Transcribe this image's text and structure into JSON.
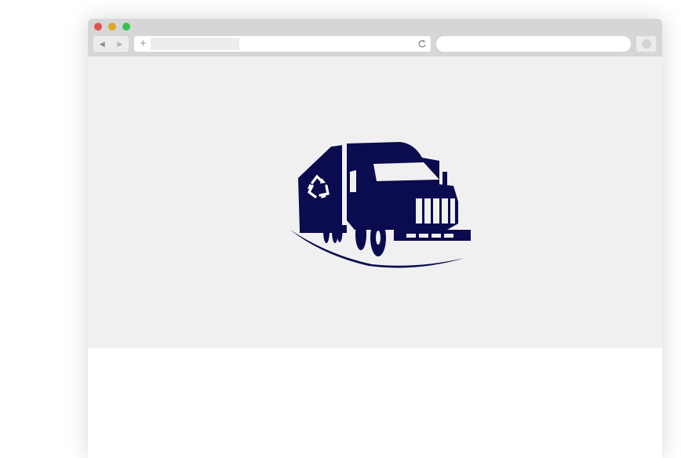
{
  "window": {
    "controls": {
      "close_color": "#e2534b",
      "minimize_color": "#d8a829",
      "maximize_color": "#35c24f"
    },
    "toolbar": {
      "back_icon": "back-arrow-icon",
      "forward_icon": "forward-arrow-icon",
      "new_tab_icon": "plus-icon",
      "reload_icon": "reload-icon",
      "address_value": "",
      "search_value": ""
    }
  },
  "hero": {
    "background": "#f0f0f1",
    "logo": {
      "icon": "recycling-truck-icon",
      "color": "#0b0b4f"
    }
  }
}
